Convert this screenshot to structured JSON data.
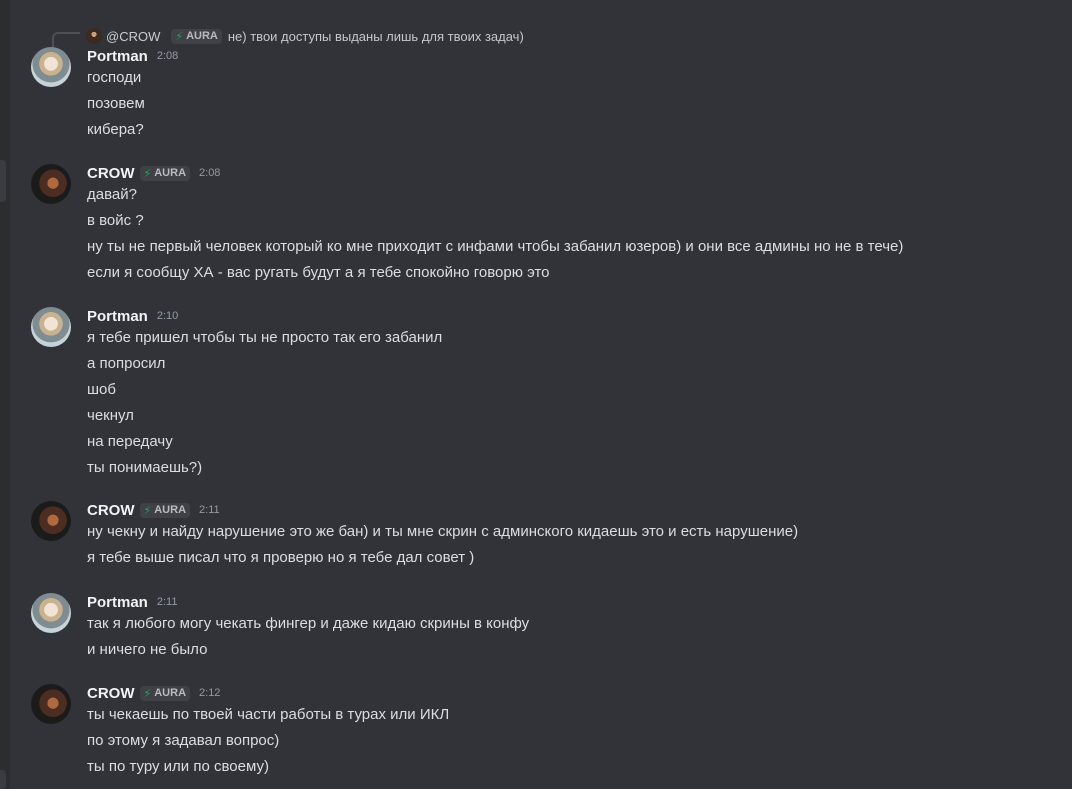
{
  "reply": {
    "author": "@CROW",
    "tag": "AURA",
    "text": "не) твои доступы выданы лишь для твоих задач)"
  },
  "messages": [
    {
      "author": "Portman",
      "avatar": "portman",
      "tag": null,
      "time": "2:08",
      "lines": [
        "господи",
        "позовем",
        "кибера?"
      ]
    },
    {
      "author": "CROW",
      "avatar": "crow",
      "tag": "AURA",
      "time": "2:08",
      "lines": [
        "давай?",
        "в войс ?",
        "ну ты не первый человек который ко мне приходит с инфами чтобы забанил юзеров) и они все админы но не в тече)",
        "если я сообщу ХА - вас ругать будут а я тебе спокойно говорю это"
      ]
    },
    {
      "author": "Portman",
      "avatar": "portman",
      "tag": null,
      "time": "2:10",
      "lines": [
        "я тебе пришел чтобы ты не просто так его забанил",
        "а попросил",
        "шоб",
        "чекнул",
        "на передачу",
        "ты понимаешь?)"
      ]
    },
    {
      "author": "CROW",
      "avatar": "crow",
      "tag": "AURA",
      "time": "2:11",
      "lines": [
        "ну чекну и найду нарушение это же бан) и ты мне скрин с админского кидаешь это и есть нарушение)",
        "я тебе выше писал что я проверю но я тебе дал совет )"
      ]
    },
    {
      "author": "Portman",
      "avatar": "portman",
      "tag": null,
      "time": "2:11",
      "lines": [
        "так я любого могу чекать фингер и даже кидаю скрины в конфу",
        "и ничего не было"
      ]
    },
    {
      "author": "CROW",
      "avatar": "crow",
      "tag": "AURA",
      "time": "2:12",
      "lines": [
        "ты чекаешь по твоей части работы в турах или ИКЛ",
        "по этому я задавал вопрос)",
        "ты по туру или по своему)"
      ]
    }
  ]
}
